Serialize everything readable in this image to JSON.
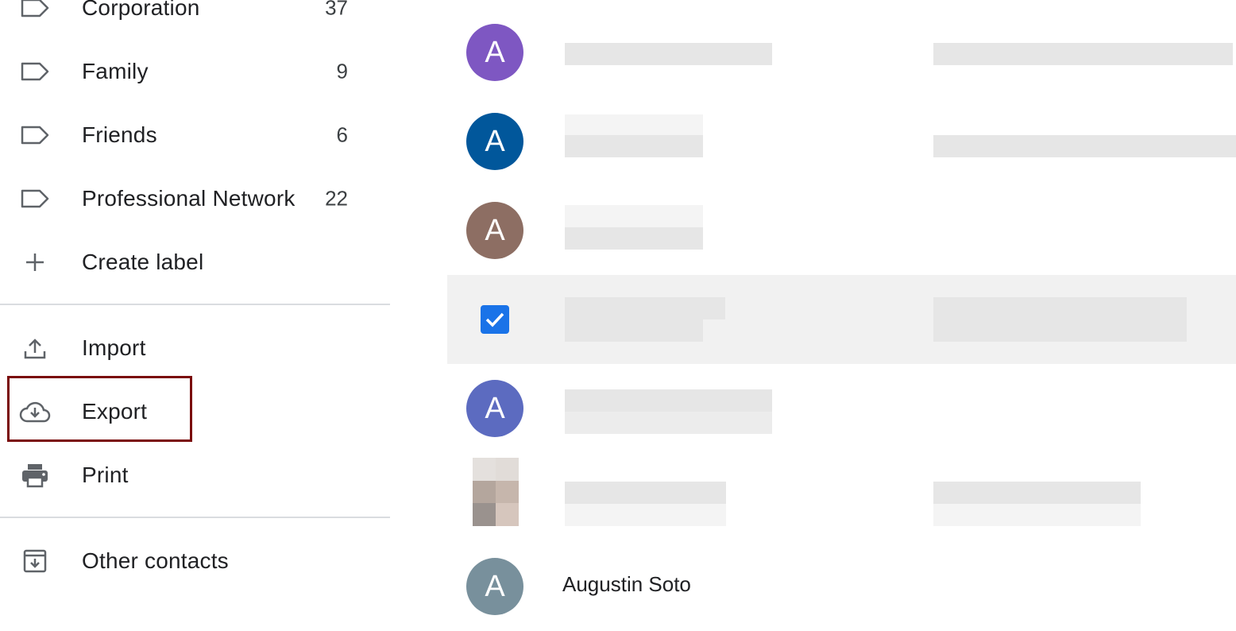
{
  "sidebar": {
    "labels": [
      {
        "name": "Corporation",
        "count": "37",
        "icon": "label-icon"
      },
      {
        "name": "Family",
        "count": "9",
        "icon": "label-icon"
      },
      {
        "name": "Friends",
        "count": "6",
        "icon": "label-icon"
      },
      {
        "name": "Professional Network",
        "count": "22",
        "icon": "label-icon"
      }
    ],
    "create_label": {
      "label": "Create label",
      "icon": "plus-icon"
    },
    "actions": [
      {
        "label": "Import",
        "icon": "upload-icon"
      },
      {
        "label": "Export",
        "icon": "cloud-download-icon"
      },
      {
        "label": "Print",
        "icon": "printer-icon"
      }
    ],
    "other_contacts": {
      "label": "Other contacts",
      "icon": "archive-download-icon"
    }
  },
  "contacts": {
    "avatars": [
      {
        "initial": "A",
        "color": "#7e57c2"
      },
      {
        "initial": "A",
        "color": "#01579b"
      },
      {
        "initial": "A",
        "color": "#8d6e63"
      },
      {
        "initial": "",
        "color": "#1a73e8"
      },
      {
        "initial": "A",
        "color": "#5c6bc0"
      },
      {
        "initial": "",
        "color": ""
      },
      {
        "initial": "A",
        "color": "#78909c"
      }
    ],
    "last_name": "Augustin Soto"
  },
  "colors": {
    "highlight_border": "#7a0b0b",
    "selected_row": "#f1f1f1",
    "checkbox": "#1a73e8"
  }
}
